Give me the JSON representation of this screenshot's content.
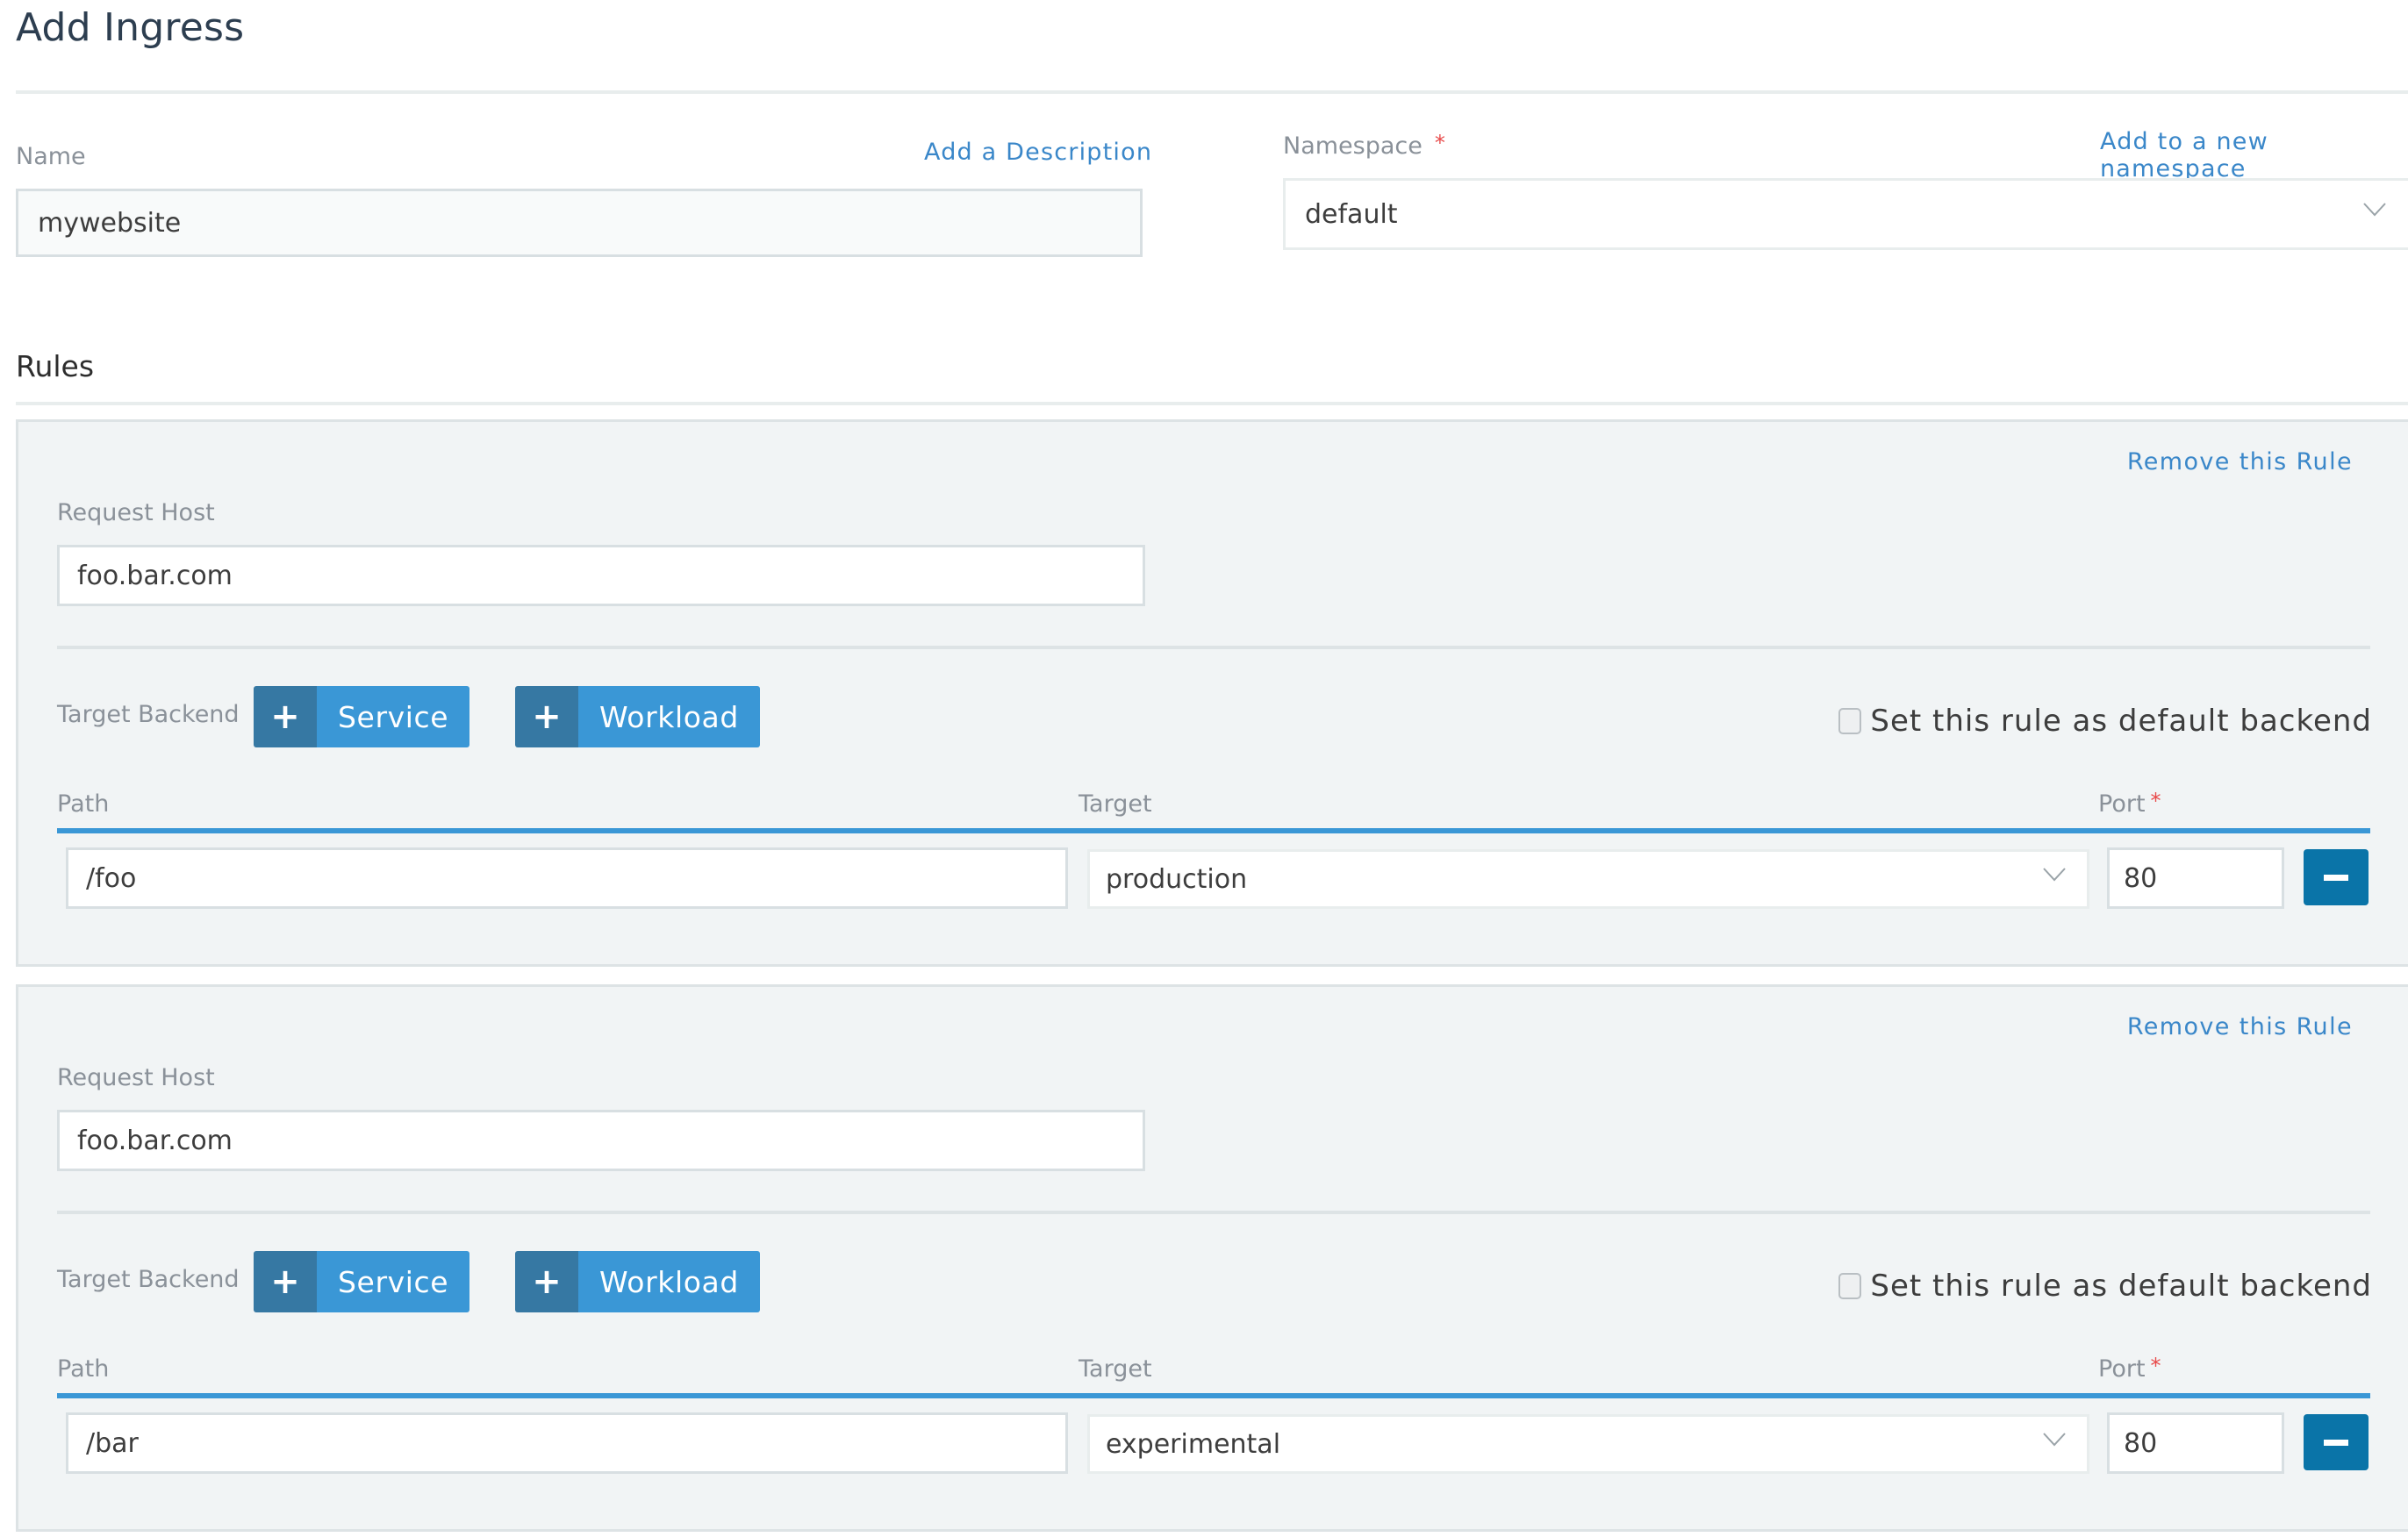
{
  "header": {
    "title": "Add Ingress"
  },
  "form": {
    "name_label": "Name",
    "name_value": "mywebsite",
    "add_description_link": "Add a Description",
    "namespace_label": "Namespace",
    "namespace_required_mark": "*",
    "add_namespace_link": "Add to a new namespace",
    "namespace_value": "default"
  },
  "rules": {
    "section_title": "Rules",
    "items": [
      {
        "remove_label": "Remove this Rule",
        "request_host_label": "Request Host",
        "request_host_value": "foo.bar.com",
        "target_backend_label": "Target Backend",
        "service_button": {
          "icon": "plus-icon",
          "label": "Service"
        },
        "workload_button": {
          "icon": "plus-icon",
          "label": "Workload"
        },
        "default_backend_label": "Set this rule as default backend",
        "default_backend_checked": false,
        "columns": {
          "path": "Path",
          "target": "Target",
          "port": "Port",
          "port_required_mark": "*"
        },
        "rows": [
          {
            "path": "/foo",
            "target": "production",
            "port": "80"
          }
        ]
      },
      {
        "remove_label": "Remove this Rule",
        "request_host_label": "Request Host",
        "request_host_value": "foo.bar.com",
        "target_backend_label": "Target Backend",
        "service_button": {
          "icon": "plus-icon",
          "label": "Service"
        },
        "workload_button": {
          "icon": "plus-icon",
          "label": "Workload"
        },
        "default_backend_label": "Set this rule as default backend",
        "default_backend_checked": false,
        "columns": {
          "path": "Path",
          "target": "Target",
          "port": "Port",
          "port_required_mark": "*"
        },
        "rows": [
          {
            "path": "/bar",
            "target": "experimental",
            "port": "80"
          }
        ]
      }
    ]
  },
  "colors": {
    "accent": "#3a97d6",
    "accent_dark": "#3678a3",
    "remove_button": "#0a74a8",
    "link": "#3a87c9",
    "required": "#e84a4a",
    "panel_bg": "#f1f4f5"
  }
}
